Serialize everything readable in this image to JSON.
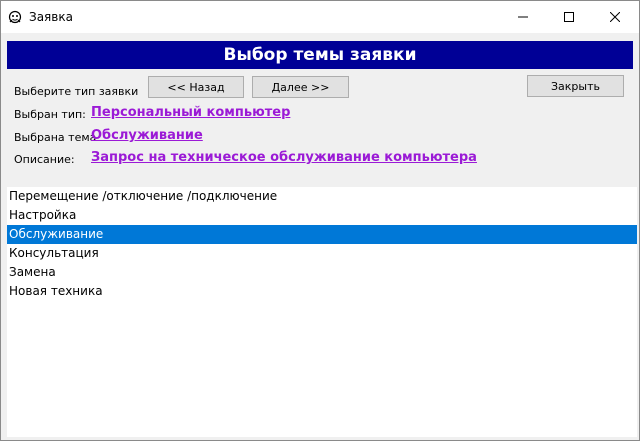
{
  "window": {
    "title": "Заявка"
  },
  "banner": {
    "title": "Выбор темы заявки"
  },
  "form": {
    "choose_type_label": "Выберите тип заявки",
    "back_button": "<< Назад",
    "next_button": "Далее >>",
    "close_button": "Закрыть",
    "selected_type_label": "Выбран тип:",
    "selected_type_value": "Персональный компьютер",
    "selected_topic_label": "Выбрана тема",
    "selected_topic_value": "Обслуживание",
    "description_label": "Описание:",
    "description_value": "Запрос на техническое обслуживание компьютера"
  },
  "topics": {
    "items": [
      {
        "label": "Перемещение /отключение /подключение",
        "selected": false
      },
      {
        "label": "Настройка",
        "selected": false
      },
      {
        "label": "Обслуживание",
        "selected": true
      },
      {
        "label": "Консультация",
        "selected": false
      },
      {
        "label": "Замена",
        "selected": false
      },
      {
        "label": "Новая техника",
        "selected": false
      }
    ]
  },
  "colors": {
    "banner_bg": "#000096",
    "link": "#9b1ad6",
    "selection": "#0078d7"
  }
}
